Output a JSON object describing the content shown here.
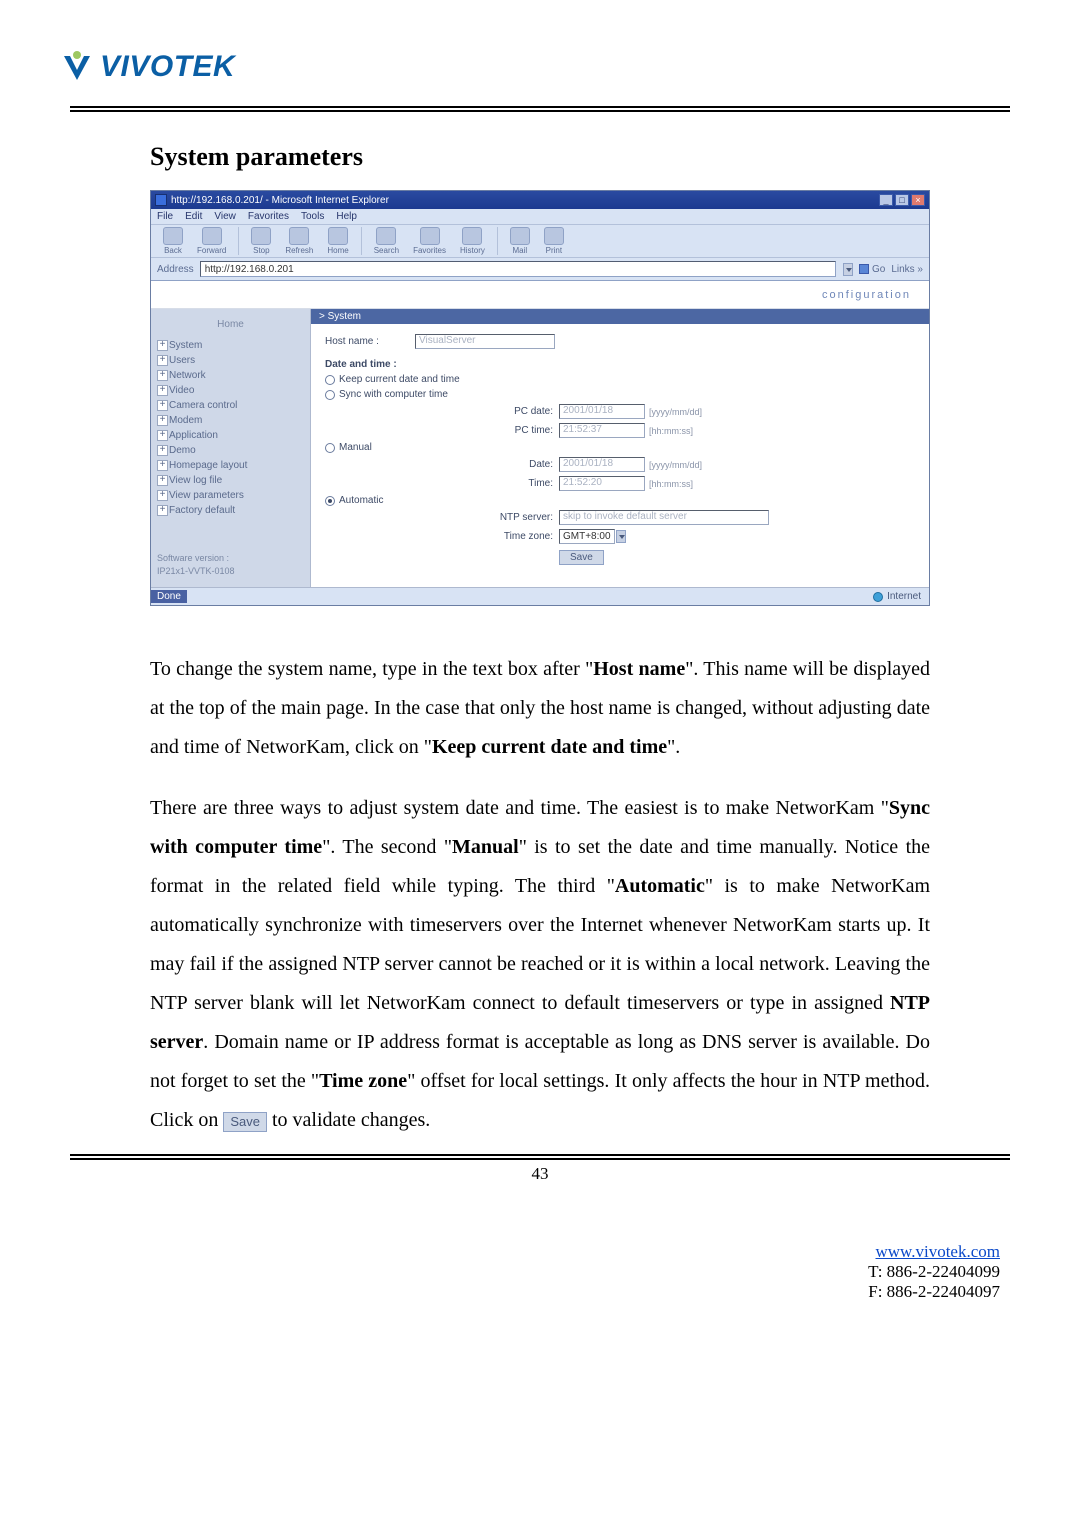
{
  "logo_text": "VIVOTEK",
  "heading": "System parameters",
  "browser": {
    "title": "http://192.168.0.201/ - Microsoft Internet Explorer",
    "menubar": [
      "File",
      "Edit",
      "View",
      "Favorites",
      "Tools",
      "Help"
    ],
    "toolbar": {
      "back": "Back",
      "forward": "Forward",
      "stop": "Stop",
      "refresh": "Refresh",
      "home": "Home",
      "search": "Search",
      "favorites": "Favorites",
      "history": "History",
      "mail": "Mail",
      "print": "Print"
    },
    "address_label": "Address",
    "address_value": "http://192.168.0.201",
    "go": "Go",
    "links": "Links »",
    "status_left": "Done",
    "status_right": "Internet"
  },
  "config_label": "configuration",
  "sidebar": {
    "home": "Home",
    "items": [
      "System",
      "Users",
      "Network",
      "Video",
      "Camera control",
      "Modem",
      "Application",
      "Demo",
      "Homepage layout",
      "View log file",
      "View parameters",
      "Factory default"
    ],
    "sw_label": "Software version :",
    "sw_value": "IP21x1-VVTK-0108"
  },
  "section": {
    "header": "> System",
    "host_label": "Host name :",
    "host_value": "VisualServer",
    "dt_label": "Date and time :",
    "opt_keep": "Keep current date and time",
    "opt_sync": "Sync with computer time",
    "pc_date_label": "PC date:",
    "pc_date_value": "2001/01/18",
    "pc_date_hint": "[yyyy/mm/dd]",
    "pc_time_label": "PC time:",
    "pc_time_value": "21:52:37",
    "pc_time_hint": "[hh:mm:ss]",
    "opt_manual": "Manual",
    "m_date_label": "Date:",
    "m_date_value": "2001/01/18",
    "m_date_hint": "[yyyy/mm/dd]",
    "m_time_label": "Time:",
    "m_time_value": "21:52:20",
    "m_time_hint": "[hh:mm:ss]",
    "opt_auto": "Automatic",
    "ntp_label": "NTP server:",
    "ntp_value": "skip to invoke default server",
    "tz_label": "Time zone:",
    "tz_value": "GMT+8:00",
    "save": "Save"
  },
  "para1_a": "To change the system name, type in the text box after \"",
  "para1_b": "Host name",
  "para1_c": "\". This name will be displayed at the top of the main page. In the case that only the host name is changed, without adjusting date and time of NetworKam, click on \"",
  "para1_d": "Keep current date and time",
  "para1_e": "\".",
  "para2_a": "There are three ways to adjust system date and time. The easiest is to make NetworKam \"",
  "para2_b": "Sync with computer time",
  "para2_c": "\". The second \"",
  "para2_d": "Manual",
  "para2_e": "\" is to set the date and time manually. Notice the format in the related field while typing. The third \"",
  "para2_f": "Automatic",
  "para2_g": "\" is to make NetworKam automatically synchronize with timeservers over the Internet whenever NetworKam starts up. It may fail if the assigned NTP server cannot be reached or it is within a local network. Leaving the NTP server blank will let NetworKam connect to default timeservers or type in assigned ",
  "para2_h": "NTP server",
  "para2_i": ". Domain name or IP address format is acceptable as long as DNS server is available. Do not forget to set the \"",
  "para2_j": "Time zone",
  "para2_k": "\" offset for local settings. It only affects the hour in NTP method. Click on ",
  "para2_save": "Save",
  "para2_l": " to validate changes.",
  "page_number": "43",
  "footer": {
    "url": "www.vivotek.com",
    "tel": "T: 886-2-22404099",
    "fax": "F: 886-2-22404097"
  }
}
